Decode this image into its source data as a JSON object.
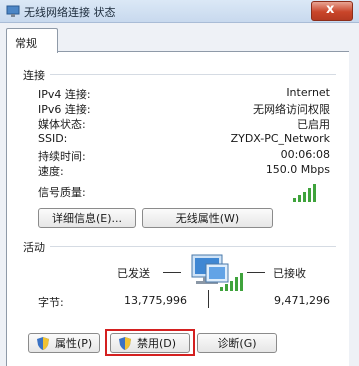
{
  "window": {
    "title": "无线网络连接 状态",
    "close_label": "x"
  },
  "tabs": [
    {
      "label": "常规",
      "selected": true
    }
  ],
  "connection": {
    "section_label": "连接",
    "rows": [
      {
        "label": "IPv4 连接:",
        "value": "Internet"
      },
      {
        "label": "IPv6 连接:",
        "value": "无网络访问权限"
      },
      {
        "label": "媒体状态:",
        "value": "已启用"
      },
      {
        "label": "SSID:",
        "value": "ZYDX-PC_Network"
      },
      {
        "label": "持续时间:",
        "value": "00:06:08"
      },
      {
        "label": "速度:",
        "value": "150.0 Mbps"
      }
    ],
    "signal_label": "信号质量:",
    "signal_bars_lit": 5,
    "details_button": "详细信息(E)...",
    "wireless_props_button": "无线属性(W)"
  },
  "activity": {
    "section_label": "活动",
    "sent_label": "已发送",
    "received_label": "已接收",
    "bytes_label": "字节:",
    "bytes_sent": "13,775,996",
    "bytes_received": "9,471,296"
  },
  "buttons": {
    "properties": "属性(P)",
    "disable": "禁用(D)",
    "diagnose": "诊断(G)"
  },
  "colors": {
    "signal": "#3fa33c",
    "highlight": "#d42020",
    "close": "#c9452a"
  }
}
